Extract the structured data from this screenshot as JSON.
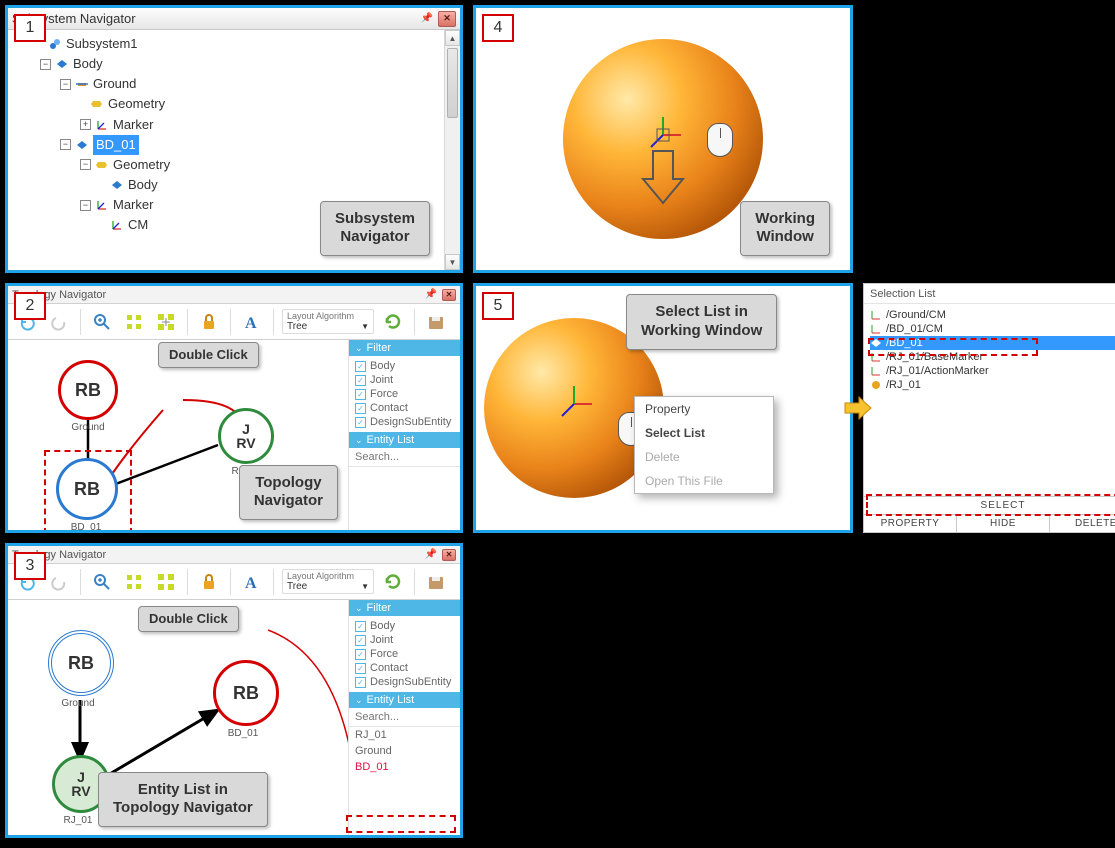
{
  "steps": {
    "s1": "1",
    "s2": "2",
    "s3": "3",
    "s4": "4",
    "s5": "5"
  },
  "callouts": {
    "subsystem": "Subsystem\nNavigator",
    "working": "Working\nWindow",
    "dblclick": "Double Click",
    "topology": "Topology\nNavigator",
    "entitylist": "Entity List in\nTopology Navigator",
    "selectlist_ww": "Select List in\nWorking Window"
  },
  "panel1": {
    "title": "Subsystem Navigator",
    "tree": {
      "root": "Subsystem1",
      "body": "Body",
      "ground": "Ground",
      "geometry": "Geometry",
      "marker": "Marker",
      "bd01": "BD_01",
      "geometry2": "Geometry",
      "body2": "Body",
      "marker2": "Marker",
      "cm": "CM"
    }
  },
  "topo": {
    "title": "Topology Navigator",
    "layout_label": "Layout Algorithm",
    "layout_value": "Tree",
    "filter_hdr": "Filter",
    "filters": [
      "Body",
      "Joint",
      "Force",
      "Contact",
      "DesignSubEntity"
    ],
    "entity_hdr": "Entity List",
    "search_ph": "Search...",
    "entities": [
      "RJ_01",
      "Ground",
      "BD_01"
    ]
  },
  "nodes": {
    "rb": "RB",
    "j_rv_1": "J",
    "j_rv_2": "RV",
    "ground": "Ground",
    "bd01": "BD_01",
    "rj01": "RJ_01"
  },
  "ctx": {
    "property": "Property",
    "selectlist": "Select List",
    "delete": "Delete",
    "openfile": "Open This File"
  },
  "sel": {
    "title": "Selection List",
    "items": [
      "/Ground/CM",
      "/BD_01/CM",
      "/BD_01",
      "/RJ_01/BaseMarker",
      "/RJ_01/ActionMarker",
      "/RJ_01"
    ],
    "select": "SELECT",
    "property": "PROPERTY",
    "hide": "HIDE",
    "delete": "DELETE"
  }
}
